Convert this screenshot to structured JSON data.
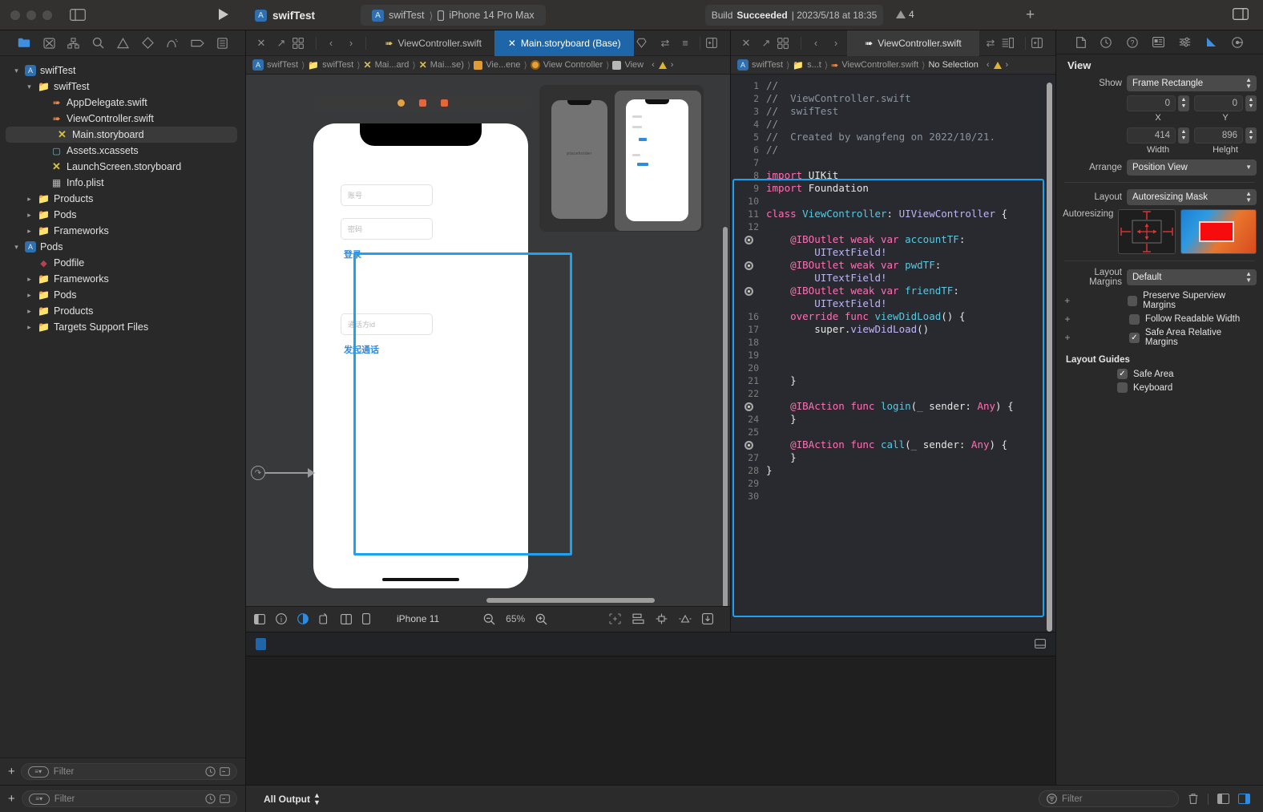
{
  "titlebar": {
    "app_name": "swifTest",
    "scheme": "swifTest",
    "destination": "iPhone 14 Pro Max",
    "status_prefix": "Build",
    "status_state": "Succeeded",
    "status_time": "| 2023/5/18 at 18:35",
    "warning_count": "4",
    "plus_label": "+"
  },
  "navigator": {
    "tabs": [
      {
        "name": "project-navigator",
        "glyph": "folder"
      },
      {
        "name": "source-control-navigator",
        "glyph": "sc"
      },
      {
        "name": "symbol-navigator",
        "glyph": "sym"
      },
      {
        "name": "find-navigator",
        "glyph": "search"
      },
      {
        "name": "issue-navigator",
        "glyph": "warn"
      },
      {
        "name": "test-navigator",
        "glyph": "test"
      },
      {
        "name": "debug-navigator",
        "glyph": "debug"
      },
      {
        "name": "breakpoint-navigator",
        "glyph": "bp"
      },
      {
        "name": "report-navigator",
        "glyph": "report"
      }
    ],
    "items": [
      {
        "label": "swifTest",
        "indent": 0,
        "icon": "project",
        "chevron": "down",
        "selected": false
      },
      {
        "label": "swifTest",
        "indent": 1,
        "icon": "folder",
        "chevron": "down",
        "selected": false
      },
      {
        "label": "AppDelegate.swift",
        "indent": 2,
        "icon": "swift",
        "chevron": "",
        "selected": false
      },
      {
        "label": "ViewController.swift",
        "indent": 2,
        "icon": "swift",
        "chevron": "",
        "selected": false
      },
      {
        "label": "Main.storyboard",
        "indent": 2,
        "icon": "storyboard",
        "chevron": "",
        "selected": true
      },
      {
        "label": "Assets.xcassets",
        "indent": 2,
        "icon": "assets",
        "chevron": "",
        "selected": false
      },
      {
        "label": "LaunchScreen.storyboard",
        "indent": 2,
        "icon": "storyboard",
        "chevron": "",
        "selected": false
      },
      {
        "label": "Info.plist",
        "indent": 2,
        "icon": "plist",
        "chevron": "",
        "selected": false
      },
      {
        "label": "Products",
        "indent": 1,
        "icon": "folder",
        "chevron": "right",
        "selected": false
      },
      {
        "label": "Pods",
        "indent": 1,
        "icon": "folder",
        "chevron": "right",
        "selected": false
      },
      {
        "label": "Frameworks",
        "indent": 1,
        "icon": "folder",
        "chevron": "right",
        "selected": false
      },
      {
        "label": "Pods",
        "indent": 0,
        "icon": "project",
        "chevron": "down",
        "selected": false
      },
      {
        "label": "Podfile",
        "indent": 1,
        "icon": "ruby",
        "chevron": "",
        "selected": false
      },
      {
        "label": "Frameworks",
        "indent": 1,
        "icon": "folder",
        "chevron": "right",
        "selected": false
      },
      {
        "label": "Pods",
        "indent": 1,
        "icon": "folder",
        "chevron": "right",
        "selected": false
      },
      {
        "label": "Products",
        "indent": 1,
        "icon": "folder",
        "chevron": "right",
        "selected": false
      },
      {
        "label": "Targets Support Files",
        "indent": 1,
        "icon": "folder",
        "chevron": "right",
        "selected": false
      }
    ],
    "filter_placeholder": "Filter",
    "add_label": "+"
  },
  "storyboard_editor": {
    "tabs": [
      {
        "label": "ViewController.swift",
        "active": false
      },
      {
        "label": "Main.storyboard (Base)",
        "active": true
      }
    ],
    "breadcrumb": [
      {
        "label": "swifTest",
        "icon": "project"
      },
      {
        "label": "swifTest",
        "icon": "folder"
      },
      {
        "label": "Mai...ard",
        "icon": "storyboard"
      },
      {
        "label": "Mai...se)",
        "icon": "storyboard"
      },
      {
        "label": "Vie...ene",
        "icon": "scene"
      },
      {
        "label": "View Controller",
        "icon": "viewcontroller"
      },
      {
        "label": "View",
        "icon": "view"
      }
    ],
    "scene": {
      "fields": [
        {
          "placeholder": "账号"
        },
        {
          "placeholder": "密码"
        },
        {
          "placeholder": "通话方id"
        }
      ],
      "buttons": [
        {
          "label": "登录"
        },
        {
          "label": "发起通话"
        }
      ]
    },
    "canvas_bar": {
      "device": "iPhone 11",
      "zoom": "65%"
    }
  },
  "code_editor": {
    "tab_label": "ViewController.swift",
    "breadcrumb": [
      {
        "label": "swifTest",
        "icon": "project"
      },
      {
        "label": "s...t",
        "icon": "folder"
      },
      {
        "label": "ViewController.swift",
        "icon": "swift"
      },
      {
        "label": "No Selection",
        "icon": ""
      }
    ],
    "lines": [
      {
        "num": "1",
        "gutter": "num",
        "segments": [
          {
            "t": "//",
            "c": "c-cmt"
          }
        ]
      },
      {
        "num": "2",
        "gutter": "num",
        "segments": [
          {
            "t": "//  ViewController.swift",
            "c": "c-cmt"
          }
        ]
      },
      {
        "num": "3",
        "gutter": "num",
        "segments": [
          {
            "t": "//  swifTest",
            "c": "c-cmt"
          }
        ]
      },
      {
        "num": "4",
        "gutter": "num",
        "segments": [
          {
            "t": "//",
            "c": "c-cmt"
          }
        ]
      },
      {
        "num": "5",
        "gutter": "num",
        "segments": [
          {
            "t": "//  Created by wangfeng on 2022/10/21.",
            "c": "c-cmt"
          }
        ]
      },
      {
        "num": "6",
        "gutter": "num",
        "segments": [
          {
            "t": "//",
            "c": "c-cmt"
          }
        ]
      },
      {
        "num": "7",
        "gutter": "num",
        "segments": []
      },
      {
        "num": "8",
        "gutter": "num",
        "segments": [
          {
            "t": "import ",
            "c": "c-kw"
          },
          {
            "t": "UIKit",
            "c": "c-plain"
          }
        ]
      },
      {
        "num": "9",
        "gutter": "num",
        "segments": [
          {
            "t": "import ",
            "c": "c-kw"
          },
          {
            "t": "Foundation",
            "c": "c-plain"
          }
        ]
      },
      {
        "num": "10",
        "gutter": "num",
        "segments": []
      },
      {
        "num": "11",
        "gutter": "num",
        "segments": [
          {
            "t": "class ",
            "c": "c-kw"
          },
          {
            "t": "ViewController",
            "c": "c-cls"
          },
          {
            "t": ": ",
            "c": "c-plain"
          },
          {
            "t": "UIViewController",
            "c": "c-type"
          },
          {
            "t": " {",
            "c": "c-plain"
          }
        ]
      },
      {
        "num": "12",
        "gutter": "num",
        "segments": []
      },
      {
        "num": "13",
        "gutter": "bullet",
        "segments": [
          {
            "t": "    @IBOutlet ",
            "c": "c-attr"
          },
          {
            "t": "weak var ",
            "c": "c-kw"
          },
          {
            "t": "accountTF",
            "c": "c-cls"
          },
          {
            "t": ":",
            "c": "c-plain"
          }
        ]
      },
      {
        "num": "14",
        "gutter": "blank",
        "segments": [
          {
            "t": "        UITextField!",
            "c": "c-type"
          }
        ]
      },
      {
        "num": "15",
        "gutter": "bullet",
        "segments": [
          {
            "t": "    @IBOutlet ",
            "c": "c-attr"
          },
          {
            "t": "weak var ",
            "c": "c-kw"
          },
          {
            "t": "pwdTF",
            "c": "c-cls"
          },
          {
            "t": ":",
            "c": "c-plain"
          }
        ]
      },
      {
        "num": "16",
        "gutter": "blank",
        "segments": [
          {
            "t": "        UITextField!",
            "c": "c-type"
          }
        ]
      },
      {
        "num": "17",
        "gutter": "bullet",
        "segments": [
          {
            "t": "    @IBOutlet ",
            "c": "c-attr"
          },
          {
            "t": "weak var ",
            "c": "c-kw"
          },
          {
            "t": "friendTF",
            "c": "c-cls"
          },
          {
            "t": ":",
            "c": "c-plain"
          }
        ]
      },
      {
        "num": "18",
        "gutter": "blank",
        "segments": [
          {
            "t": "        UITextField!",
            "c": "c-type"
          }
        ]
      },
      {
        "num": "16",
        "gutter": "num",
        "segments": [
          {
            "t": "    override func ",
            "c": "c-kw"
          },
          {
            "t": "viewDidLoad",
            "c": "c-fn"
          },
          {
            "t": "() {",
            "c": "c-plain"
          }
        ]
      },
      {
        "num": "17",
        "gutter": "num",
        "segments": [
          {
            "t": "        super.",
            "c": "c-plain"
          },
          {
            "t": "viewDidLoad",
            "c": "c-type"
          },
          {
            "t": "()",
            "c": "c-plain"
          }
        ]
      },
      {
        "num": "18",
        "gutter": "num",
        "segments": []
      },
      {
        "num": "19",
        "gutter": "num",
        "segments": []
      },
      {
        "num": "20",
        "gutter": "num",
        "segments": []
      },
      {
        "num": "21",
        "gutter": "num",
        "segments": [
          {
            "t": "    }",
            "c": "c-plain"
          }
        ]
      },
      {
        "num": "22",
        "gutter": "num",
        "segments": []
      },
      {
        "num": "23",
        "gutter": "bullet",
        "segments": [
          {
            "t": "    @IBAction func ",
            "c": "c-kw"
          },
          {
            "t": "login",
            "c": "c-fn"
          },
          {
            "t": "(",
            "c": "c-plain"
          },
          {
            "t": "_ ",
            "c": "c-kw"
          },
          {
            "t": "sender: ",
            "c": "c-plain"
          },
          {
            "t": "Any",
            "c": "c-attr"
          },
          {
            "t": ") {",
            "c": "c-plain"
          }
        ]
      },
      {
        "num": "24",
        "gutter": "num",
        "segments": [
          {
            "t": "    }",
            "c": "c-plain"
          }
        ]
      },
      {
        "num": "25",
        "gutter": "num",
        "segments": []
      },
      {
        "num": "26",
        "gutter": "bullet",
        "segments": [
          {
            "t": "    @IBAction func ",
            "c": "c-kw"
          },
          {
            "t": "call",
            "c": "c-fn"
          },
          {
            "t": "(",
            "c": "c-plain"
          },
          {
            "t": "_ ",
            "c": "c-kw"
          },
          {
            "t": "sender: ",
            "c": "c-plain"
          },
          {
            "t": "Any",
            "c": "c-attr"
          },
          {
            "t": ") {",
            "c": "c-plain"
          }
        ]
      },
      {
        "num": "27",
        "gutter": "num",
        "segments": [
          {
            "t": "    }",
            "c": "c-plain"
          }
        ]
      },
      {
        "num": "28",
        "gutter": "num",
        "segments": [
          {
            "t": "}",
            "c": "c-plain"
          }
        ]
      },
      {
        "num": "29",
        "gutter": "num",
        "segments": []
      },
      {
        "num": "30",
        "gutter": "num",
        "segments": []
      }
    ]
  },
  "inspector": {
    "title": "View",
    "show_label": "Show",
    "show_value": "Frame Rectangle",
    "x_value": "0",
    "y_value": "0",
    "x_caption": "X",
    "y_caption": "Y",
    "width_value": "414",
    "height_value": "896",
    "width_caption": "Width",
    "height_caption": "Helght",
    "arrange_label": "Arrange",
    "arrange_value": "Position View",
    "layout_label": "Layout",
    "layout_value": "Autoresizing Mask",
    "autoresizing_label": "Autoresizing",
    "layout_margins_label": "Layout Margins",
    "layout_margins_value": "Default",
    "checkboxes": [
      {
        "label": "Preserve Superview Margins",
        "checked": false
      },
      {
        "label": "Follow Readable Width",
        "checked": false
      },
      {
        "label": "Safe Area Relative Margins",
        "checked": true
      }
    ],
    "layout_guides_label": "Layout Guides",
    "guides": [
      {
        "label": "Safe Area",
        "checked": true
      },
      {
        "label": "Keyboard",
        "checked": false
      }
    ]
  },
  "bottombar": {
    "add_label": "+",
    "nav_filter_placeholder": "Filter",
    "all_output": "All Output",
    "console_filter_placeholder": "Filter"
  },
  "colors": {
    "accent_blue": "#1ea1f0",
    "tab_active": "#1f66a8",
    "warning_yellow": "#e0b32e",
    "swift_orange": "#e8874b"
  }
}
